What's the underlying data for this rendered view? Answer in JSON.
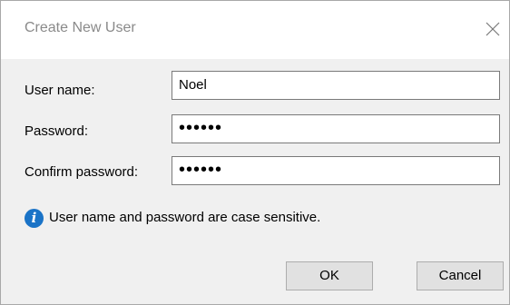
{
  "window": {
    "title": "Create New User",
    "close_glyph": "close-icon"
  },
  "form": {
    "username_label": "User name:",
    "username_value": "Noel",
    "password_label": "Password:",
    "password_value": "••••••",
    "confirm_label": "Confirm password:",
    "confirm_value": "••••••"
  },
  "info": {
    "icon": "info-icon",
    "icon_glyph": "i",
    "text": "User name and password are case sensitive."
  },
  "buttons": {
    "ok_label": "OK",
    "cancel_label": "Cancel"
  },
  "colors": {
    "accent_info": "#1a73c7",
    "title_text": "#8a8a8a",
    "button_face": "#e1e1e1"
  }
}
